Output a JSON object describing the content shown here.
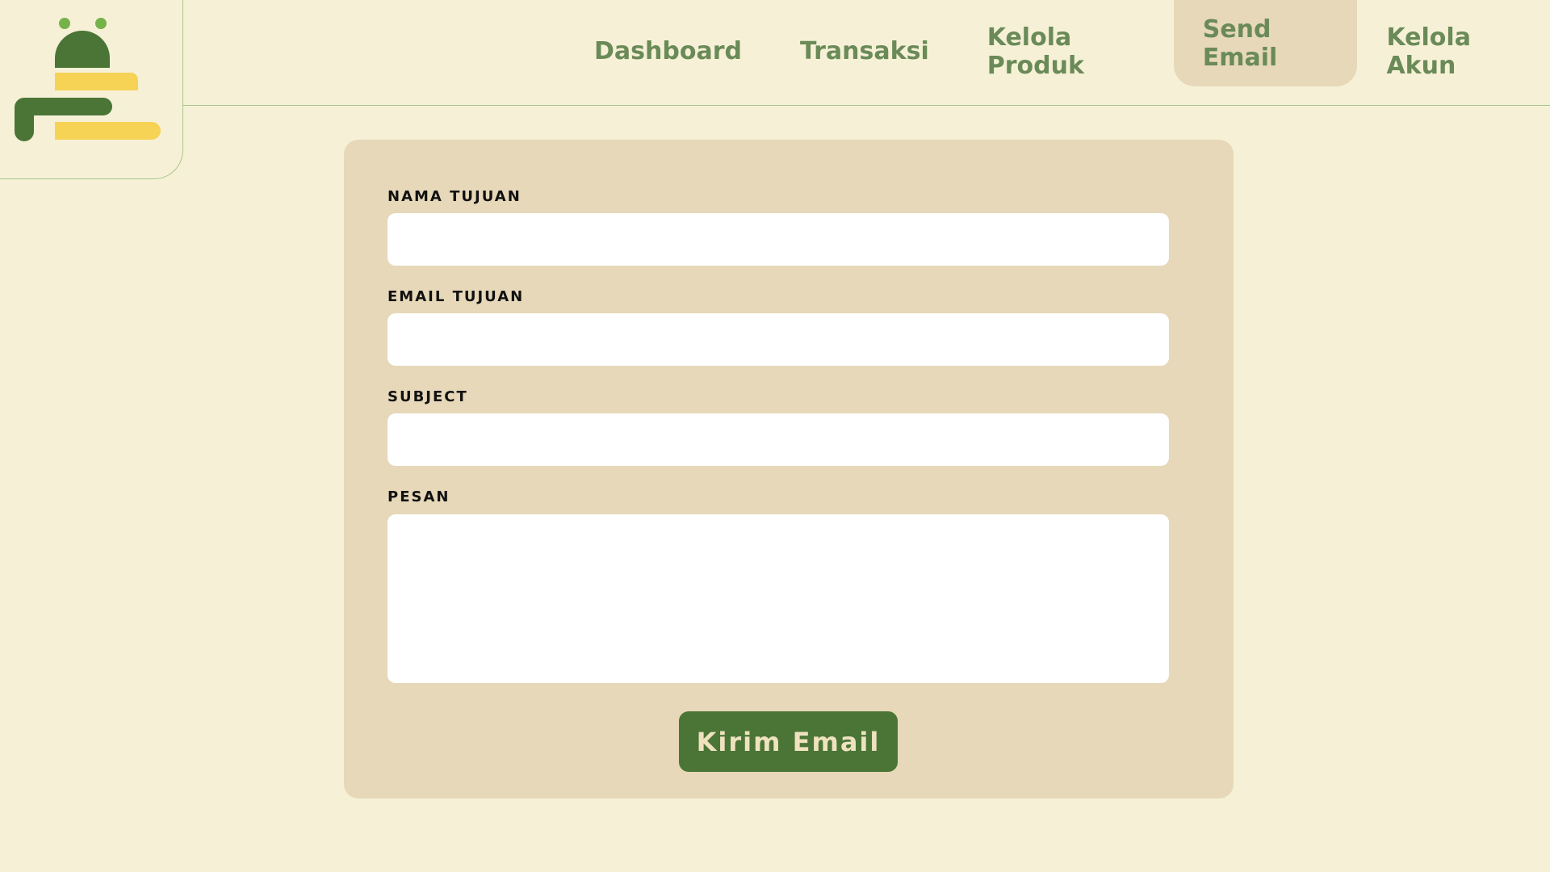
{
  "logo": {
    "icon": "brand-logo-icon",
    "colors": {
      "green": "#4a7536",
      "light_green": "#76b24a",
      "yellow": "#f6d255"
    }
  },
  "nav": {
    "items": [
      {
        "label": "Dashboard",
        "active": false
      },
      {
        "label": "Transaksi",
        "active": false
      },
      {
        "label": "Kelola Produk",
        "active": false
      },
      {
        "label": "Send Email",
        "active": true
      },
      {
        "label": "Kelola Akun",
        "active": false
      }
    ]
  },
  "form": {
    "fields": [
      {
        "label": "NAMA TUJUAN",
        "value": "",
        "placeholder": ""
      },
      {
        "label": "EMAIL TUJUAN",
        "value": "",
        "placeholder": ""
      },
      {
        "label": "SUBJECT",
        "value": "",
        "placeholder": ""
      },
      {
        "label": "PESAN",
        "value": "",
        "placeholder": ""
      }
    ],
    "submit_label": "Kirim Email"
  },
  "colors": {
    "background": "#f6f1d6",
    "panel": "#e6d8b8",
    "nav_text": "#6a8a58",
    "button": "#4a7536",
    "button_text": "#efe2bf",
    "divider": "#a8c48c"
  }
}
